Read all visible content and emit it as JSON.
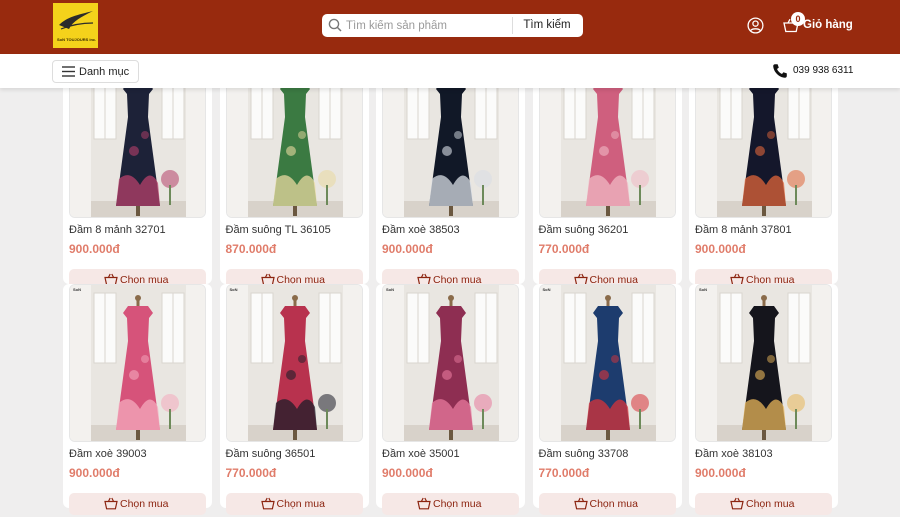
{
  "colors": {
    "header_bg": "#982a0e",
    "logo_bg": "#f4d21b",
    "price": "#e07c6a",
    "buy_button_bg": "#f6e8e6",
    "buy_button_text": "#8c2410"
  },
  "header": {
    "logo_text": "SoN TOUJOURS inc.",
    "search": {
      "placeholder": "Tìm kiếm sản phẩm",
      "value": "",
      "button_label": "Tìm kiếm",
      "icon": "search-icon"
    },
    "user_icon": "user-icon",
    "cart": {
      "icon": "shopping-basket-icon",
      "count": "0",
      "label": "Giỏ hàng"
    }
  },
  "subbar": {
    "menu_label": "Danh mục",
    "menu_icon": "hamburger-icon",
    "phone_icon": "phone-icon",
    "phone": "039 938 6311"
  },
  "products": [
    {
      "name": "Đầm 8 mảnh 32701",
      "price": "900.000đ",
      "buy_label": "Chọn mua",
      "dress_color": "#1d2238",
      "accent": "#b5406a",
      "sleeve": "short"
    },
    {
      "name": "Đầm suông TL 36105",
      "price": "870.000đ",
      "buy_label": "Chọn mua",
      "dress_color": "#3b7a42",
      "accent": "#e9d9a0",
      "sleeve": "short"
    },
    {
      "name": "Đầm xoè 38503",
      "price": "900.000đ",
      "buy_label": "Chọn mua",
      "dress_color": "#111827",
      "accent": "#d8dde6",
      "sleeve": "short"
    },
    {
      "name": "Đầm suông 36201",
      "price": "770.000đ",
      "buy_label": "Chọn mua",
      "dress_color": "#cf5f7e",
      "accent": "#f0b8c4",
      "sleeve": "short"
    },
    {
      "name": "Đầm 8 mảnh 37801",
      "price": "900.000đ",
      "buy_label": "Chọn mua",
      "dress_color": "#14172b",
      "accent": "#e0663a",
      "sleeve": "short"
    },
    {
      "name": "Đầm xoè 39003",
      "price": "900.000đ",
      "buy_label": "Chọn mua",
      "dress_color": "#d6537a",
      "accent": "#f4a9bd",
      "sleeve": "short"
    },
    {
      "name": "Đầm suông 36501",
      "price": "770.000đ",
      "buy_label": "Chọn mua",
      "dress_color": "#b8324e",
      "accent": "#1e1e2a",
      "sleeve": "short"
    },
    {
      "name": "Đầm xoè 35001",
      "price": "900.000đ",
      "buy_label": "Chọn mua",
      "dress_color": "#8e2e52",
      "accent": "#e77a9e",
      "sleeve": "short"
    },
    {
      "name": "Đầm suông 33708",
      "price": "770.000đ",
      "buy_label": "Chọn mua",
      "dress_color": "#1d3c6e",
      "accent": "#d8333a",
      "sleeve": "short"
    },
    {
      "name": "Đầm xoè 38103",
      "price": "900.000đ",
      "buy_label": "Chọn mua",
      "dress_color": "#15151c",
      "accent": "#e8b65a",
      "sleeve": "short"
    }
  ]
}
